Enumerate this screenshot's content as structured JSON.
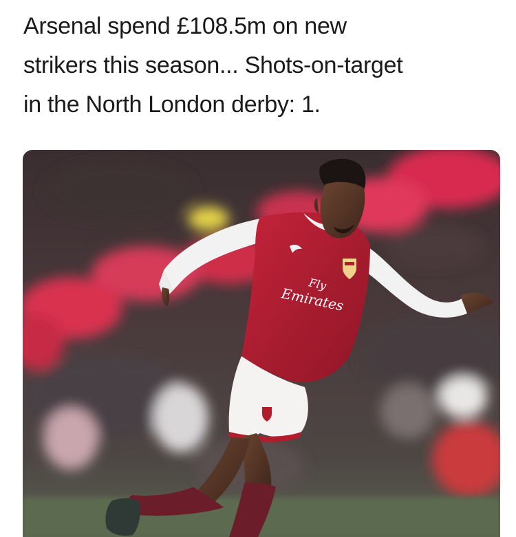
{
  "post": {
    "caption_lines": [
      "Arsenal spend £108.5m on new",
      "strikers this season... Shots-on-target",
      "in the North London derby: 1."
    ],
    "photo": {
      "shirt_sponsor_line1": "Fly",
      "shirt_sponsor_line2": "Emirates",
      "colors": {
        "shirt_red": "#b31c2c",
        "sleeve_white": "#f2f2f2",
        "sock_maroon": "#6b1d2a",
        "crowd_pink": "#e0395a",
        "pitch_green": "#5c6a4f"
      }
    }
  }
}
